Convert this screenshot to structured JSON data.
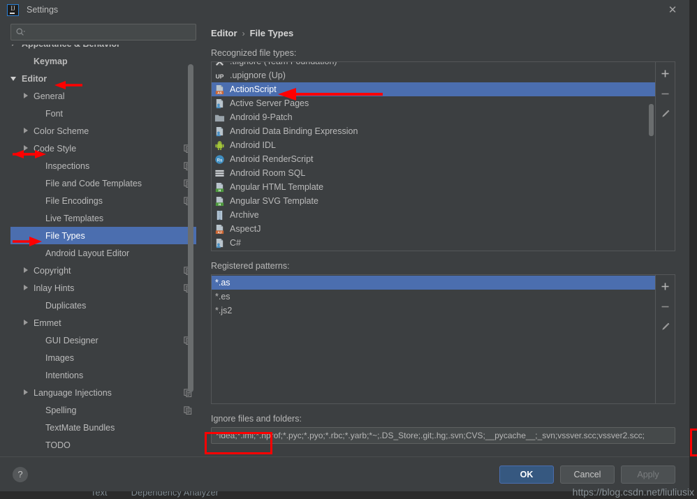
{
  "window": {
    "title": "Settings",
    "app_icon": "intellij-idea-logo",
    "close_icon": "close-icon"
  },
  "search": {
    "value": "",
    "placeholder": "",
    "icon": "search-icon"
  },
  "sidebar": {
    "scrollbar": "sidebar-scrollbar",
    "items": [
      {
        "label": "Appearance & Behavior",
        "indent": 0,
        "twisty": "closed",
        "bold": true,
        "selected": false,
        "copy_icon": false
      },
      {
        "label": "Keymap",
        "indent": 1,
        "twisty": "none",
        "bold": true,
        "selected": false,
        "copy_icon": false
      },
      {
        "label": "Editor",
        "indent": 0,
        "twisty": "open",
        "bold": true,
        "selected": false,
        "copy_icon": false
      },
      {
        "label": "General",
        "indent": 1,
        "twisty": "closed",
        "bold": false,
        "selected": false,
        "copy_icon": false
      },
      {
        "label": "Font",
        "indent": 2,
        "twisty": "none",
        "bold": false,
        "selected": false,
        "copy_icon": false
      },
      {
        "label": "Color Scheme",
        "indent": 1,
        "twisty": "closed",
        "bold": false,
        "selected": false,
        "copy_icon": false
      },
      {
        "label": "Code Style",
        "indent": 1,
        "twisty": "closed",
        "bold": false,
        "selected": false,
        "copy_icon": true
      },
      {
        "label": "Inspections",
        "indent": 2,
        "twisty": "none",
        "bold": false,
        "selected": false,
        "copy_icon": true
      },
      {
        "label": "File and Code Templates",
        "indent": 2,
        "twisty": "none",
        "bold": false,
        "selected": false,
        "copy_icon": true
      },
      {
        "label": "File Encodings",
        "indent": 2,
        "twisty": "none",
        "bold": false,
        "selected": false,
        "copy_icon": true
      },
      {
        "label": "Live Templates",
        "indent": 2,
        "twisty": "none",
        "bold": false,
        "selected": false,
        "copy_icon": false
      },
      {
        "label": "File Types",
        "indent": 2,
        "twisty": "none",
        "bold": false,
        "selected": true,
        "copy_icon": false
      },
      {
        "label": "Android Layout Editor",
        "indent": 2,
        "twisty": "none",
        "bold": false,
        "selected": false,
        "copy_icon": false
      },
      {
        "label": "Copyright",
        "indent": 1,
        "twisty": "closed",
        "bold": false,
        "selected": false,
        "copy_icon": true
      },
      {
        "label": "Inlay Hints",
        "indent": 1,
        "twisty": "closed",
        "bold": false,
        "selected": false,
        "copy_icon": true
      },
      {
        "label": "Duplicates",
        "indent": 2,
        "twisty": "none",
        "bold": false,
        "selected": false,
        "copy_icon": false
      },
      {
        "label": "Emmet",
        "indent": 1,
        "twisty": "closed",
        "bold": false,
        "selected": false,
        "copy_icon": false
      },
      {
        "label": "GUI Designer",
        "indent": 2,
        "twisty": "none",
        "bold": false,
        "selected": false,
        "copy_icon": true
      },
      {
        "label": "Images",
        "indent": 2,
        "twisty": "none",
        "bold": false,
        "selected": false,
        "copy_icon": false
      },
      {
        "label": "Intentions",
        "indent": 2,
        "twisty": "none",
        "bold": false,
        "selected": false,
        "copy_icon": false
      },
      {
        "label": "Language Injections",
        "indent": 1,
        "twisty": "closed",
        "bold": false,
        "selected": false,
        "copy_icon": true
      },
      {
        "label": "Spelling",
        "indent": 2,
        "twisty": "none",
        "bold": false,
        "selected": false,
        "copy_icon": true
      },
      {
        "label": "TextMate Bundles",
        "indent": 2,
        "twisty": "none",
        "bold": false,
        "selected": false,
        "copy_icon": false
      },
      {
        "label": "TODO",
        "indent": 2,
        "twisty": "none",
        "bold": false,
        "selected": false,
        "copy_icon": false
      }
    ]
  },
  "breadcrumb": {
    "root": "Editor",
    "separator": "›",
    "current": "File Types"
  },
  "recognized": {
    "label": "Recognized file types:",
    "items": [
      {
        "name": ".tfignore (Team Foundation)",
        "icon": "tf-ignore-icon",
        "selected": false
      },
      {
        "name": ".upignore (Up)",
        "icon": "up-ignore-icon",
        "selected": false
      },
      {
        "name": "ActionScript",
        "icon": "actionscript-icon",
        "selected": true
      },
      {
        "name": "Active Server Pages",
        "icon": "asp-icon",
        "selected": false
      },
      {
        "name": "Android 9-Patch",
        "icon": "folder-icon",
        "selected": false
      },
      {
        "name": "Android Data Binding Expression",
        "icon": "asp-icon",
        "selected": false
      },
      {
        "name": "Android IDL",
        "icon": "android-robot-icon",
        "selected": false
      },
      {
        "name": "Android RenderScript",
        "icon": "renderscript-icon",
        "selected": false
      },
      {
        "name": "Android Room SQL",
        "icon": "sql-table-icon",
        "selected": false
      },
      {
        "name": "Angular HTML Template",
        "icon": "angular-html-icon",
        "selected": false
      },
      {
        "name": "Angular SVG Template",
        "icon": "angular-html-icon",
        "selected": false
      },
      {
        "name": "Archive",
        "icon": "archive-icon",
        "selected": false
      },
      {
        "name": "AspectJ",
        "icon": "aspectj-icon",
        "selected": false
      },
      {
        "name": "C#",
        "icon": "asp-icon",
        "selected": false
      }
    ],
    "toolbar": [
      {
        "icon": "plus-icon",
        "name": "add-file-type-button"
      },
      {
        "icon": "minus-icon",
        "name": "remove-file-type-button"
      },
      {
        "icon": "pencil-icon",
        "name": "edit-file-type-button"
      }
    ]
  },
  "patterns": {
    "label": "Registered patterns:",
    "items": [
      {
        "value": "*.as",
        "selected": true
      },
      {
        "value": "*.es",
        "selected": false
      },
      {
        "value": "*.js2",
        "selected": false
      }
    ],
    "toolbar": [
      {
        "icon": "plus-icon",
        "name": "add-pattern-button"
      },
      {
        "icon": "minus-icon",
        "name": "remove-pattern-button"
      },
      {
        "icon": "pencil-icon",
        "name": "edit-pattern-button"
      }
    ]
  },
  "ignore": {
    "label": "Ignore files and folders:",
    "value": "*idea;*.iml;*.hprof;*.pyc;*.pyo;*.rbc;*.yarb;*~;.DS_Store;.git;.hg;.svn;CVS;__pycache__;_svn;vssver.scc;vssver2.scc;"
  },
  "footer": {
    "help_icon": "question-mark-icon",
    "ok_label": "OK",
    "cancel_label": "Cancel",
    "apply_label": "Apply"
  },
  "watermark": "https://blog.csdn.net/liuliusix",
  "background_tabs": [
    "Text",
    "Dependency Analyzer"
  ],
  "colors": {
    "selection": "#4b6eaf",
    "panel": "#3c3f41",
    "annotation": "#ff0000",
    "primary_button": "#365880"
  }
}
